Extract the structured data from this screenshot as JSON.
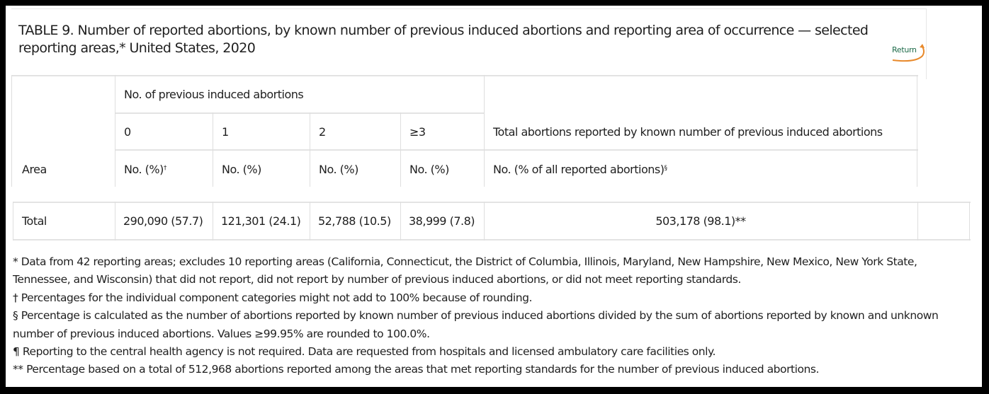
{
  "table": {
    "title": "TABLE 9. Number of reported abortions, by known number of previous induced abortions and reporting area of occurrence — selected reporting areas,* United States, 2020",
    "return_label": "Return",
    "header": {
      "area": "Area",
      "group_label": "No. of previous induced abortions",
      "categories": [
        "0",
        "1",
        "2",
        "≥3"
      ],
      "total_label": "Total abortions reported by known number of previous induced abortions",
      "subheaders": [
        "No. (%)",
        "No. (%)",
        "No. (%)",
        "No. (%)"
      ],
      "subheader_first_marker": "†",
      "total_subheader": "No. (% of all reported abortions)",
      "total_subheader_marker": "§"
    },
    "rows": [
      {
        "area": "Total",
        "values": [
          "290,090 (57.7)",
          "121,301 (24.1)",
          "52,788 (10.5)",
          "38,999 (7.8)"
        ],
        "total": "503,178 (98.1)**"
      }
    ]
  },
  "footnotes": [
    "* Data from 42 reporting areas; excludes 10 reporting areas (California, Connecticut, the District of Columbia, Illinois, Maryland, New Hampshire, New Mexico, New York State, Tennessee, and Wisconsin) that did not report, did not report by number of previous induced abortions, or did not meet reporting standards.",
    "† Percentages for the individual component categories might not add to 100% because of rounding.",
    "§ Percentage is calculated as the number of abortions reported by known number of previous induced abortions divided by the sum of abortions reported by known and unknown number of previous induced abortions. Values ≥99.95% are rounded to 100.0%.",
    "¶ Reporting to the central health agency is not required. Data are requested from hospitals and licensed ambulatory care facilities only.",
    "** Percentage based on a total of 512,968 abortions reported among the areas that met reporting standards for the number of previous induced abortions."
  ],
  "colors": {
    "return_text": "#1e6b4a",
    "return_arrow": "#e8892b",
    "border": "#e3e3e3"
  }
}
